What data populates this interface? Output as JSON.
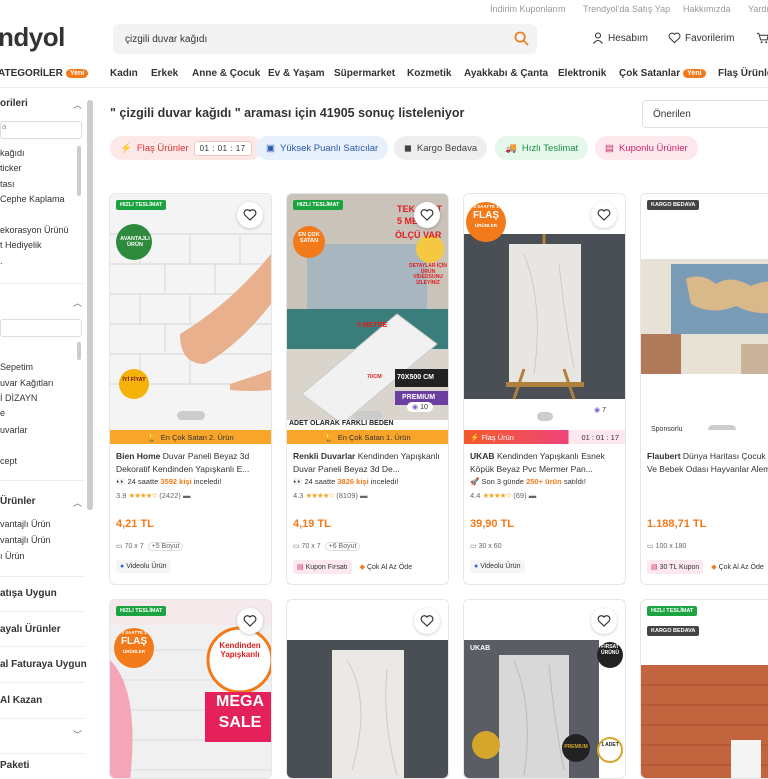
{
  "topbar": {
    "links": [
      "İndirim Kuponlarım",
      "Trendyol'da Satış Yap",
      "Hakkımızda",
      "Yardım"
    ]
  },
  "header": {
    "logo": "ndyol",
    "search_value": "çizgili duvar kağıdı",
    "account_label": "Hesabım",
    "favorites_label": "Favorilerim"
  },
  "nav": {
    "categories_label": "ATEGORİLER",
    "new_badge": "Yeni",
    "items": [
      "Kadın",
      "Erkek",
      "Anne & Çocuk",
      "Ev & Yaşam",
      "Süpermarket",
      "Kozmetik",
      "Ayakkabı & Çanta",
      "Elektronik",
      "Çok Satanlar",
      "Flaş Ürünler"
    ]
  },
  "sidebar": {
    "section1_title": "orileri",
    "section1_input": "a",
    "section1_items": [
      "kağıdı",
      "ticker",
      "tası",
      "Cephe Kaplama",
      "ekorasyon Ürünü",
      "t Hediyelik",
      "."
    ],
    "section2_title": "",
    "section2_items": [
      "Sepetim",
      "uvar Kağıtları",
      "İ DİZAYN",
      "e",
      "uvarlar",
      "",
      "cept",
      "'"
    ],
    "section3_title": "Ürünler",
    "section3_items": [
      "vantajlı Ürün",
      "vantajlı Ürün",
      "ı Ürün"
    ],
    "links": [
      "atışa Uygun",
      "ayalı Ürünler",
      "al Faturaya Uygun",
      "Al Kazan"
    ],
    "last": "Paketi"
  },
  "results": {
    "title": "\" çizgili duvar kağıdı \" araması için 41905 sonuç listeleniyor",
    "sort_value": "Önerilen"
  },
  "filters": [
    {
      "label": "Flaş Ürünler",
      "timer": "01 : 01 : 17"
    },
    {
      "label": "Yüksek Puanlı Satıcılar"
    },
    {
      "label": "Kargo Bedava"
    },
    {
      "label": "Hızlı Teslimat"
    },
    {
      "label": "Kuponlu Ürünler"
    }
  ],
  "products": [
    {
      "badge": "HIZLI TESLİMAT",
      "image_labels": [
        "AVANTAJLI ÜRÜN",
        "İYİ FİYAT"
      ],
      "ribbon": "En Çok Satan 2. Ürün",
      "brand": "Bien Home",
      "title": "Duvar Paneli Beyaz 3d Dekoratif Kendinden Yapışkanlı E...",
      "social_prefix": "24 saatte",
      "social_highlight": "3592 kişi",
      "social_suffix": "inceledi!",
      "rating": "3.9",
      "stars": "★★★★☆",
      "reviews": "(2422)",
      "price": "4,21 TL",
      "size": "70 x 7",
      "size_more": "+5 Boyut",
      "tags": [
        "Videolu Ürün"
      ]
    },
    {
      "badge": "HIZLI TESLİMAT",
      "image_labels": [
        "EN ÇOK SATAN",
        "TEK FİYAT",
        "5 METRE",
        "ÖLÇÜ VAR",
        "DETAYLAR İÇİN ÜRÜN VİDEOSUNU İZLEYİNİZ",
        "5 METRE",
        "70CM",
        "70X500 CM",
        "PREMIUM",
        "ADET OLARAK FARKLI BEDEN"
      ],
      "ribbon": "En Çok Satan 1. Ürün",
      "brand": "Renkli Duvarlar",
      "title": "Kendinden Yapışkanlı Duvar Paneli Beyaz 3d De...",
      "social_prefix": "24 saatte",
      "social_highlight": "3826 kişi",
      "social_suffix": "inceledi!",
      "rating": "4.3",
      "stars": "★★★★☆",
      "reviews": "(8109)",
      "color_count": "10",
      "price": "4,19 TL",
      "size": "70 x 7",
      "size_more": "+6 Boyut",
      "tags": [
        "Kupon Fırsatı",
        "Çok Al Az Öde"
      ]
    },
    {
      "badge": "",
      "image_labels": [
        "3 SAATTE 1",
        "FLAŞ",
        "ÜRÜNLER"
      ],
      "ribbon": "Flaş Ürün",
      "ribbon_timer": "01 : 01 : 17",
      "brand": "UKAB",
      "title": "Kendinden Yapışkanlı Esnek Köpük Beyaz Pvc Mermer Pan...",
      "social_prefix": "Son 3 günde",
      "social_highlight": "250+ ürün",
      "social_suffix": "satıldı!",
      "rating": "4.4",
      "stars": "★★★★☆",
      "reviews": "(69)",
      "color_count": "7",
      "price": "39,90 TL",
      "size": "30 x 60",
      "size_more": "",
      "tags": [
        "Videolu Ürün"
      ]
    },
    {
      "badge": "KARGO BEDAVA",
      "image_labels": [],
      "ribbon": "",
      "sponsor": "Sponsorlu",
      "brand": "Flaubert",
      "title": "Dünya Haritası Çocuk Ve Bebek Odası Hayvanlar Alemi",
      "price": "1.188,71 TL",
      "size": "100 x 180",
      "size_more": "",
      "tags": [
        "30 TL Kupon",
        "Çok Al Az Öde"
      ]
    }
  ],
  "row2": [
    {
      "badge": "HIZLI TESLİMAT",
      "image_labels": [
        "3 SAATTE 1",
        "FLAŞ",
        "ÜRÜNLER",
        "Kendinden Yapışkanlı",
        "MEGA",
        "SALE"
      ]
    },
    {
      "badge": "",
      "image_labels": []
    },
    {
      "badge": "",
      "image_labels": [
        "UKAB",
        "FIRSAT ÜRÜNÜ",
        "PREMIUM",
        "1 ADET"
      ]
    },
    {
      "badge": "HIZLI TESLİMAT",
      "badge2": "KARGO BEDAVA",
      "image_labels": []
    }
  ]
}
